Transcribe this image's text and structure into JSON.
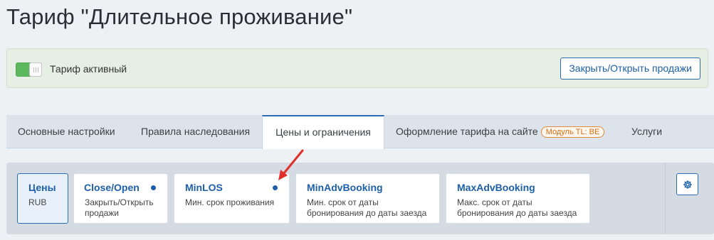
{
  "page": {
    "title": "Тариф \"Длительное проживание\""
  },
  "status": {
    "toggle_label": "Тариф активный",
    "sales_button": "Закрыть/Открыть продажи"
  },
  "tabs": [
    {
      "label": "Основные настройки"
    },
    {
      "label": "Правила наследования"
    },
    {
      "label": "Цены и ограничения",
      "active": true
    },
    {
      "label": "Оформление тарифа на сайте",
      "badge": "Модуль TL: BE"
    },
    {
      "label": "Услуги"
    }
  ],
  "cards": [
    {
      "title": "Цены",
      "subtitle": "RUB",
      "active": true
    },
    {
      "title": "Close/Open",
      "subtitle_line1": "Закрыть/Открыть",
      "subtitle_line2": "продажи",
      "dot": true
    },
    {
      "title": "MinLOS",
      "subtitle_line1": "Мин. срок проживания",
      "dot": true
    },
    {
      "title": "MinAdvBooking",
      "subtitle_line1": "Мин. срок от даты",
      "subtitle_line2": "бронирования до даты заезда"
    },
    {
      "title": "MaxAdvBooking",
      "subtitle_line1": "Макс. срок от даты",
      "subtitle_line2": "бронирования до даты заезда"
    }
  ],
  "colors": {
    "accent": "#1d5fa8",
    "active_toggle": "#5cb85c",
    "annotation_arrow": "#e0302a",
    "badge": "#e08a3a"
  },
  "icons": {
    "settings": "gear-icon"
  }
}
